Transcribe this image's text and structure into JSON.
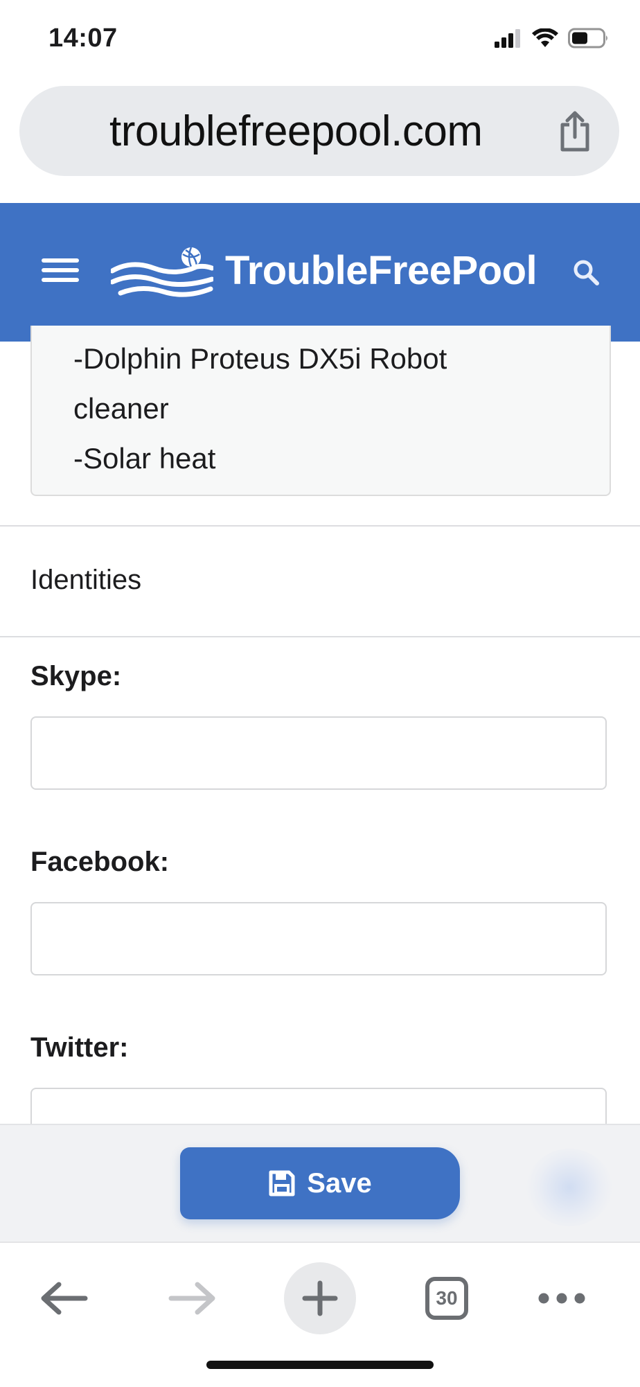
{
  "status_bar": {
    "time": "14:07"
  },
  "browser": {
    "url": "troublefreepool.com",
    "tab_count": "30"
  },
  "header": {
    "brand": "TroubleFreePool"
  },
  "card": {
    "lines": [
      "-Dolphin Proteus DX5i Robot",
      "cleaner",
      "-Solar heat"
    ]
  },
  "identities": {
    "title": "Identities",
    "fields": [
      {
        "label": "Skype:",
        "value": ""
      },
      {
        "label": "Facebook:",
        "value": ""
      },
      {
        "label": "Twitter:",
        "value": ""
      }
    ]
  },
  "save": {
    "label": "Save"
  },
  "colors": {
    "brand_blue": "#3f72c4",
    "url_bar": "#e8eaed"
  },
  "icons": [
    "signal-icon",
    "wifi-icon",
    "battery-icon",
    "share-icon",
    "menu-icon",
    "logo-icon",
    "search-icon",
    "save-disk-icon",
    "back-arrow-icon",
    "forward-arrow-icon",
    "plus-icon",
    "tabs-icon",
    "more-icon"
  ]
}
